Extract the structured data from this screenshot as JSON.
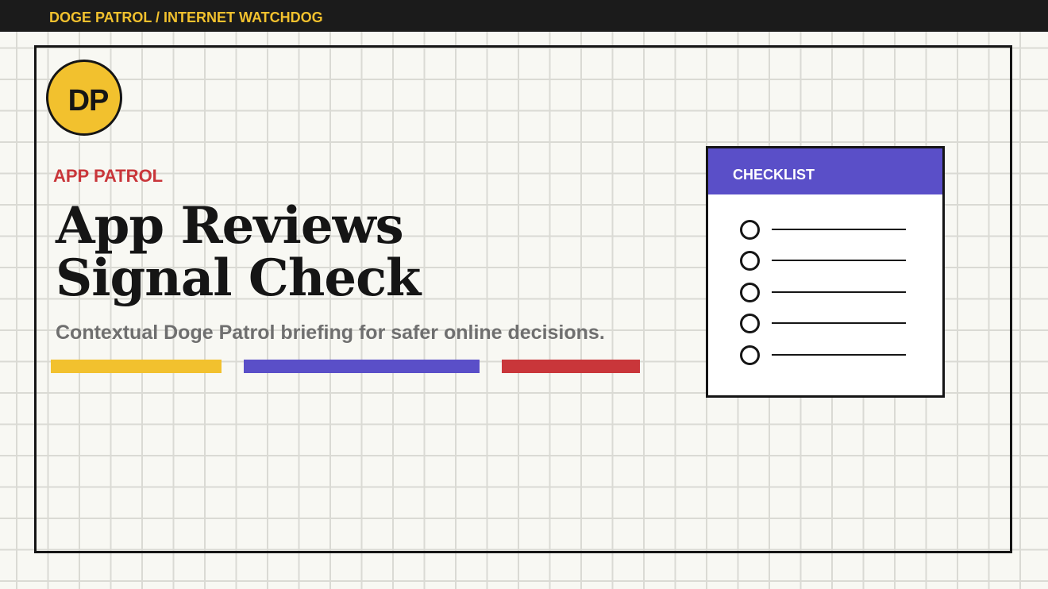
{
  "topbar": {
    "title": "DOGE PATROL / INTERNET WATCHDOG"
  },
  "logo": {
    "initials": "DP"
  },
  "main": {
    "eyebrow": "APP PATROL",
    "headline_line1": "App Reviews",
    "headline_line2": "Signal Check",
    "subtitle": "Contextual Doge Patrol briefing for safer online decisions."
  },
  "accent_bars": [
    {
      "name": "yellow",
      "color": "#f2c12e"
    },
    {
      "name": "blue",
      "color": "#5a4fc8"
    },
    {
      "name": "red",
      "color": "#c9363a"
    }
  ],
  "checklist": {
    "title": "CHECKLIST",
    "item_count": 5
  },
  "colors": {
    "topbar_background": "#1b1b1b",
    "brand_yellow": "#f2c12e",
    "brand_blue": "#5a4fc8",
    "brand_red": "#c9363a",
    "subtitle_gray": "#6f6f6f"
  }
}
